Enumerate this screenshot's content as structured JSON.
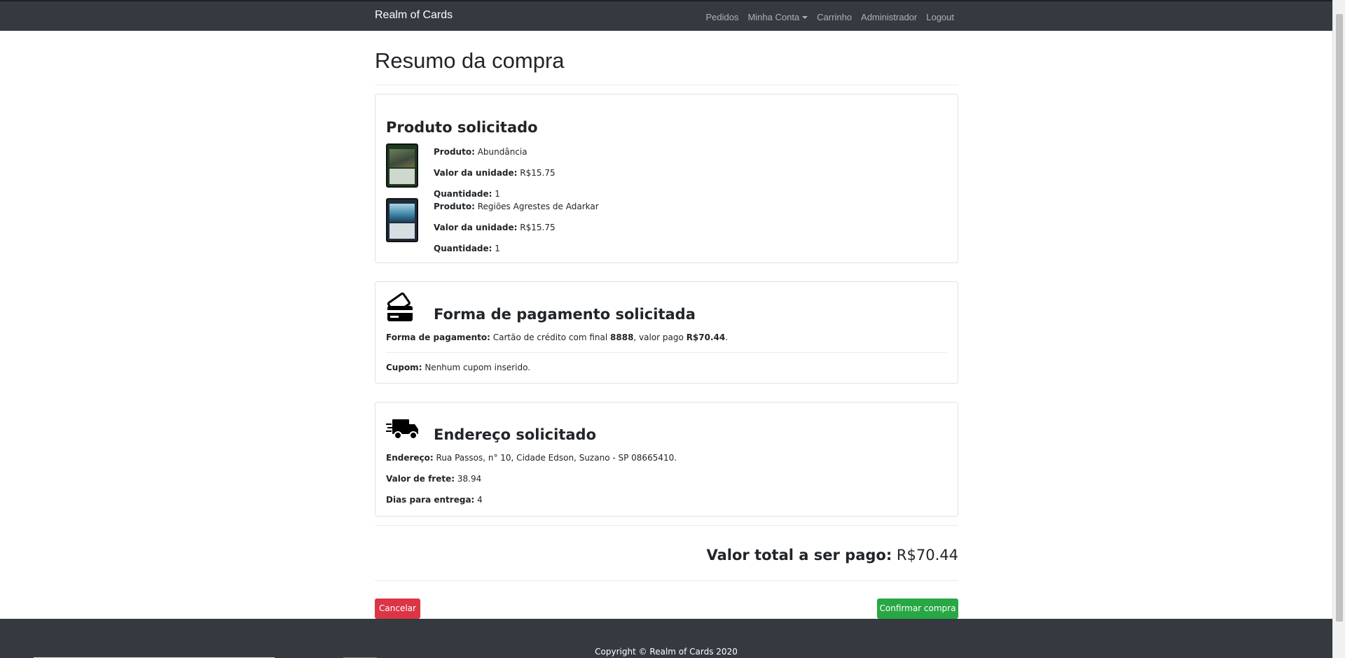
{
  "navbar": {
    "brand": "Realm of Cards",
    "items": [
      "Pedidos",
      "Minha Conta",
      "Carrinho",
      "Administrador",
      "Logout"
    ]
  },
  "page": {
    "title": "Resumo da compra"
  },
  "products": {
    "heading": "Produto solicitado",
    "labels": {
      "product": "Produto:",
      "unit_price": "Valor da unidade:",
      "quantity": "Quantidade:"
    },
    "items": [
      {
        "name": "Abundância",
        "unit_price": "R$15.75",
        "quantity": "1"
      },
      {
        "name": "Regiões Agrestes de Adarkar",
        "unit_price": "R$15.75",
        "quantity": "1"
      }
    ]
  },
  "payment": {
    "heading": "Forma de pagamento solicitada",
    "label": "Forma de pagamento:",
    "text_before": "Cartão de crédito com final",
    "card_final": "8888",
    "text_mid": ", valor pago",
    "amount": "R$70.44",
    "text_end": ".",
    "coupon_label": "Cupom:",
    "coupon_value": "Nenhum cupom inserido."
  },
  "address": {
    "heading": "Endereço solicitado",
    "address_label": "Endereço:",
    "address_value": "Rua Passos, n° 10, Cidade Edson, Suzano - SP 08665410.",
    "freight_label": "Valor de frete:",
    "freight_value": "38.94",
    "days_label": "Dias para entrega:",
    "days_value": "4"
  },
  "total": {
    "label": "Valor total a ser pago:",
    "value": "R$70.44"
  },
  "actions": {
    "cancel": "Cancelar",
    "confirm": "Confirmar compra"
  },
  "footer": {
    "copyright": "Copyright © Realm of Cards 2020"
  }
}
